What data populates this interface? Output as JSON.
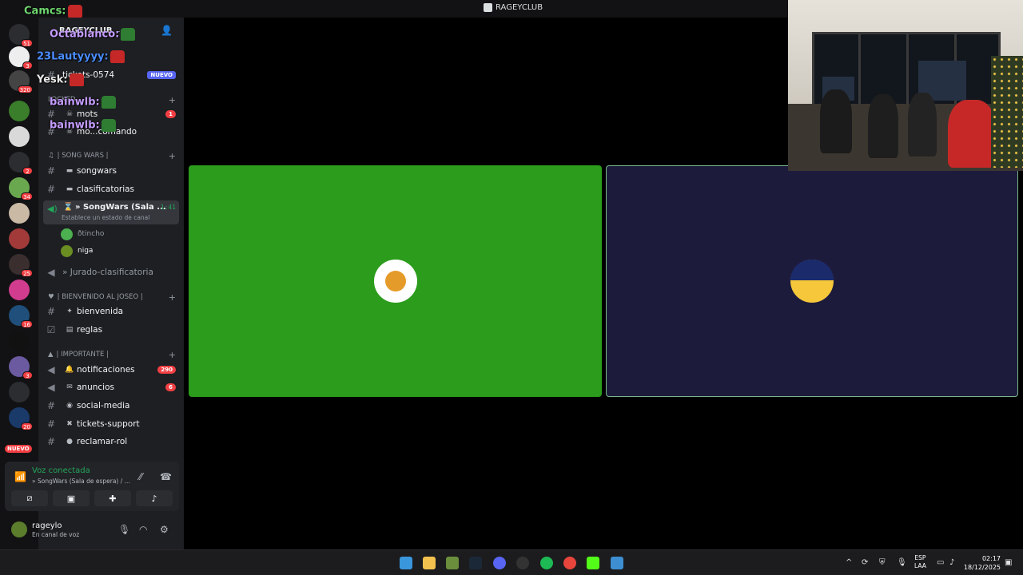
{
  "window": {
    "title": "RAGEYCLUB"
  },
  "server": {
    "name": "RAGEYCLUB"
  },
  "rail_badges": [
    "51",
    "3",
    "320",
    "2",
    "34",
    "25",
    "16",
    "3",
    "20"
  ],
  "rail_new": "NUEVO",
  "channels_top": [
    {
      "name": "tickets-0574",
      "tag": "NUEVO"
    },
    {
      "name": "mots",
      "count": "1"
    },
    {
      "name": "mo...comando"
    }
  ],
  "categories": {
    "songwars": "| SONG WARS |",
    "bienvenido": "| BIENVENIDO AL JOSEO |",
    "importante": "| IMPORTANTE |",
    "locked": "LOCKED"
  },
  "songwars_channels": [
    "songwars",
    "clasificatorias"
  ],
  "voice_channel": {
    "name": "» SongWars (Sala ...",
    "time": "1:41",
    "status": "Establece un estado de canal",
    "users": [
      "ðtincho",
      "niga"
    ]
  },
  "jurado": "» Jurado-clasificatoria",
  "bienvenido_channels": [
    "bienvenida",
    "reglas"
  ],
  "importante_channels": [
    {
      "name": "notificaciones",
      "count": "290"
    },
    {
      "name": "anuncios",
      "count": "6"
    },
    {
      "name": "social-media"
    },
    {
      "name": "tickets-support"
    },
    {
      "name": "reclamar-rol"
    }
  ],
  "chat_overlay": [
    {
      "user": "Camcs:",
      "color": "#6fd66f"
    },
    {
      "user": "Octablanco:",
      "color": "#c49cff"
    },
    {
      "user": "23Lautyyyy:",
      "color": "#4a8cff"
    },
    {
      "user": "Yesk:",
      "color": "#e8e8e8"
    },
    {
      "user": "bainwlb:",
      "color": "#c49cff"
    },
    {
      "user": "bainwlb:",
      "color": "#c49cff"
    }
  ],
  "voice_connected": {
    "status": "Voz conectada",
    "channel": "» SongWars (Sala de espera) / ..."
  },
  "user_panel": {
    "name": "rageylo",
    "status": "En canal de voz"
  },
  "taskbar": {
    "lang": [
      "ESP",
      "LAA"
    ],
    "time": "02:17",
    "date": "18/12/2025"
  }
}
